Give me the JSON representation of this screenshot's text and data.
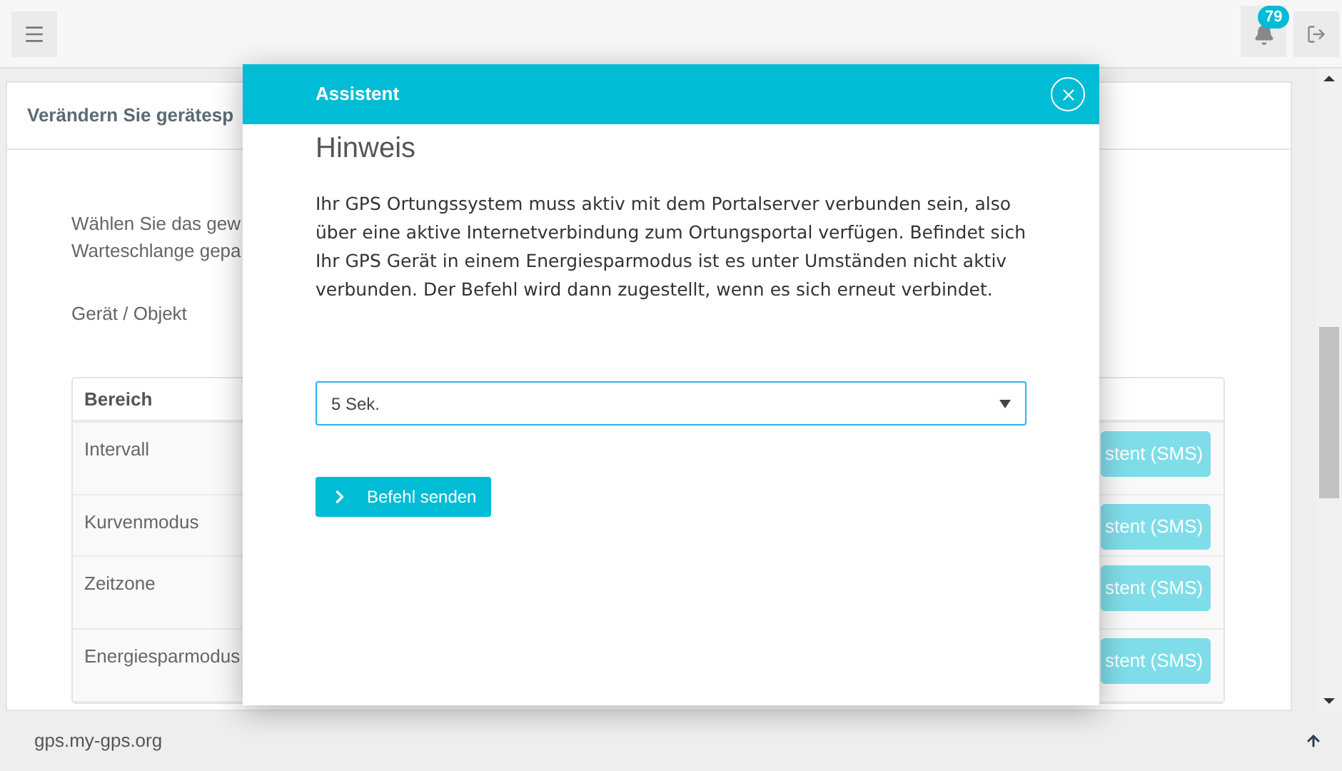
{
  "topbar": {
    "notification_count": "79"
  },
  "card": {
    "title": "Verändern Sie gerätesp",
    "intro_lines": [
      "Wählen Sie das gew",
      "Warteschlange gepa"
    ],
    "device_label": "Gerät / Objekt",
    "table": {
      "columns": [
        "Bereich"
      ],
      "rows": [
        {
          "name": "Intervall",
          "action": "stent (SMS)"
        },
        {
          "name": "Kurvenmodus",
          "action": "stent (SMS)"
        },
        {
          "name": "Zeitzone",
          "action": "stent (SMS)"
        },
        {
          "name": "Energiesparmodus",
          "action": "stent (SMS)"
        }
      ]
    }
  },
  "modal": {
    "title": "Assistent",
    "heading": "Hinweis",
    "text": "Ihr GPS Ortungssystem muss aktiv mit dem Portalserver verbunden sein, also über eine aktive Internetverbindung zum Ortungsportal verfügen. Befindet sich Ihr GPS Gerät in einem Energiesparmodus ist es unter Umständen nicht aktiv verbunden. Der Befehl wird dann zugestellt, wenn es sich erneut verbindet.",
    "select": {
      "value": "5 Sek."
    },
    "button": "Befehl senden"
  },
  "footer": {
    "domain": "gps.my-gps.org"
  }
}
